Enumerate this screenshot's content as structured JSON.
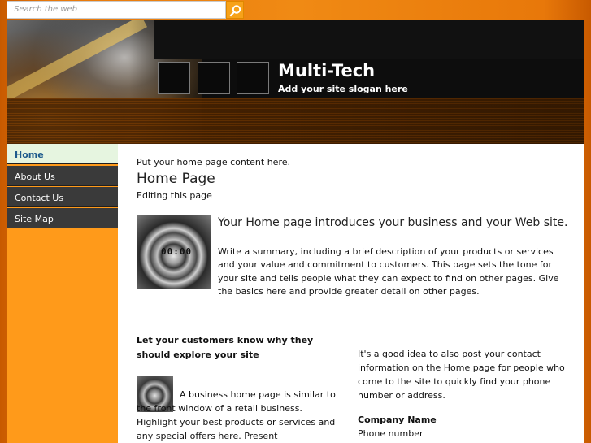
{
  "search": {
    "placeholder": "Search the web"
  },
  "header": {
    "title": "Multi-Tech",
    "slogan": "Add your site slogan here"
  },
  "nav": {
    "items": [
      {
        "label": "Home",
        "active": true
      },
      {
        "label": "About Us",
        "active": false
      },
      {
        "label": "Contact Us",
        "active": false
      },
      {
        "label": "Site Map",
        "active": false
      }
    ]
  },
  "main": {
    "intro": "Put your home page content here.",
    "title": "Home Page",
    "subtitle": "Editing this page",
    "image_digits": "00:00",
    "lead": "Your Home page introduces your business and your Web site.",
    "summary": "Write a summary, including a brief description of your products or services and your value and commitment to customers. This page sets the tone for your site and tells people what they can expect to find on other pages. Give the basics here and provide greater detail on other pages.",
    "left_heading": "Let your customers know why they should explore your site",
    "left_text": "A business home page is similar to the front window of a retail business. Highlight your best products or services and any special offers here. Present",
    "right_text": "It's a good idea to also post your contact information on the Home page for people who come to the site to quickly find your phone number or address.",
    "company_label": "Company Name",
    "phone_label": "Phone number"
  },
  "colors": {
    "accent_orange": "#ff9a1a",
    "nav_dark": "#3a3a3a",
    "nav_active_bg": "#e6f5e0",
    "nav_active_text": "#1d5a8c"
  }
}
